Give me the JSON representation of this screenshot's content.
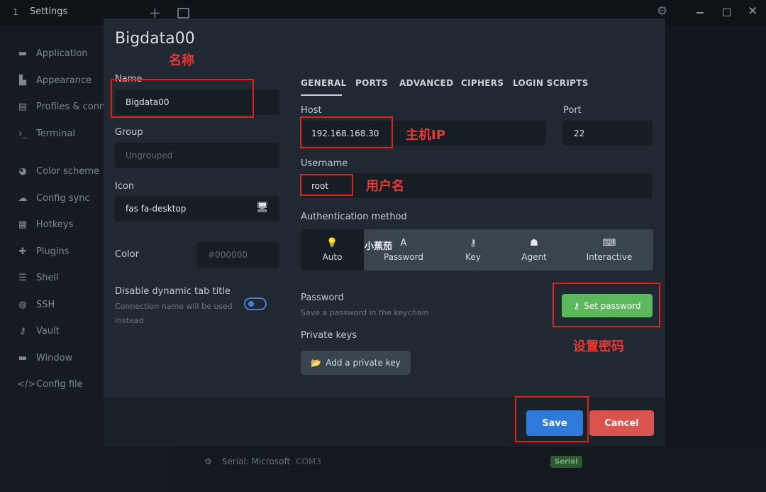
{
  "titlebar": {
    "tab_number": "1",
    "title": "Settings"
  },
  "sidebar": {
    "items": [
      {
        "label": "Application",
        "icon": "window-icon"
      },
      {
        "label": "Appearance",
        "icon": "paint-icon"
      },
      {
        "label": "Profiles & connections",
        "icon": "profiles-icon"
      },
      {
        "label": "Terminal",
        "icon": "terminal-icon"
      },
      {
        "label": "Color scheme",
        "icon": "palette-icon"
      },
      {
        "label": "Config sync",
        "icon": "cloud-icon"
      },
      {
        "label": "Hotkeys",
        "icon": "keyboard-icon"
      },
      {
        "label": "Plugins",
        "icon": "puzzle-icon"
      },
      {
        "label": "Shell",
        "icon": "list-icon"
      },
      {
        "label": "SSH",
        "icon": "globe-icon"
      },
      {
        "label": "Vault",
        "icon": "key-icon"
      },
      {
        "label": "Window",
        "icon": "window-icon"
      },
      {
        "label": "Config file",
        "icon": "code-icon"
      }
    ]
  },
  "background_list": {
    "serial_name": "Serial: Microsoft",
    "serial_port": "COM3",
    "serial_badge": "Serial"
  },
  "modal": {
    "title": "Bigdata00",
    "left": {
      "name_label": "Name",
      "name_value": "Bigdata00",
      "group_label": "Group",
      "group_placeholder": "Ungrouped",
      "icon_label": "Icon",
      "icon_value": "fas fa-desktop",
      "color_label": "Color",
      "color_placeholder": "#000000",
      "dyn_title_label": "Disable dynamic tab title",
      "dyn_title_help_1": "Connection name will be used",
      "dyn_title_help_2": "instead",
      "dyn_title_enabled": false
    },
    "tabs": [
      "GENERAL",
      "PORTS",
      "ADVANCED",
      "CIPHERS",
      "LOGIN SCRIPTS"
    ],
    "active_tab": "GENERAL",
    "host_label": "Host",
    "host_value": "192.168.168.30",
    "port_label": "Port",
    "port_value": "22",
    "username_label": "Username",
    "username_value": "root",
    "auth_label": "Authentication method",
    "auth_options": [
      {
        "label": "Auto",
        "icon": "lightbulb-icon"
      },
      {
        "label": "Password",
        "icon": "text-icon"
      },
      {
        "label": "Key",
        "icon": "key-icon"
      },
      {
        "label": "Agent",
        "icon": "agent-icon"
      },
      {
        "label": "Interactive",
        "icon": "keyboard-icon"
      }
    ],
    "auth_selected": "Auto",
    "password_label": "Password",
    "password_help": "Save a password in the keychain",
    "set_password_label": "Set password",
    "private_keys_label": "Private keys",
    "add_private_key_label": "Add a private key",
    "save_label": "Save",
    "cancel_label": "Cancel"
  },
  "annotations": {
    "name": "名称",
    "host_ip": "主机IP",
    "username": "用户名",
    "set_password": "设置密码",
    "watermark": "小蕉茄"
  },
  "colors": {
    "accent": "#2f7ad8",
    "success": "#5cb85c",
    "danger": "#d9534f",
    "annotation_red": "#e0201b",
    "modal_bg": "#202931"
  }
}
